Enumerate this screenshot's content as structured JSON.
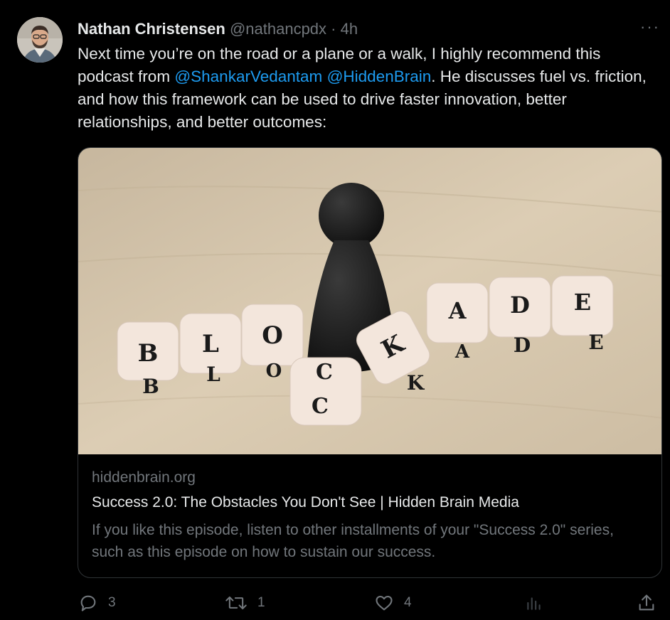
{
  "tweet": {
    "author_name": "Nathan Christensen",
    "handle": "@nathancpdx",
    "separator": "·",
    "time": "4h",
    "more_label": "···",
    "text_parts": {
      "p1": "Next time you’re on the road or a plane or a walk, I highly recommend this podcast from ",
      "mention1": "@ShankarVedantam",
      "p2": " ",
      "mention2": "@HiddenBrain",
      "p3": ". He discusses fuel vs. friction, and how this framework can be used to drive faster innovation, better relationships, and better outcomes:"
    }
  },
  "card": {
    "domain": "hiddenbrain.org",
    "title": "Success 2.0: The Obstacles You Don't See | Hidden Brain Media",
    "description": "If you like this episode, listen to other installments of your \"Success 2.0\" series, such as this episode on how to sustain our success.",
    "dice_top": [
      "B",
      "L",
      "O",
      "K",
      "A",
      "D",
      "E"
    ],
    "dice_bottom": [
      "B",
      "L",
      "O",
      "C",
      "K",
      "A",
      "D",
      "E"
    ],
    "dice_extra": [
      "C"
    ]
  },
  "actions": {
    "replies": "3",
    "retweets": "1",
    "likes": "4"
  },
  "colors": {
    "background": "#000000",
    "text": "#e7e9ea",
    "secondary": "#71767b",
    "link": "#1d9bf0",
    "border": "#2f3336"
  },
  "icons": [
    "reply-icon",
    "retweet-icon",
    "like-icon",
    "views-icon",
    "share-icon",
    "more-icon"
  ]
}
